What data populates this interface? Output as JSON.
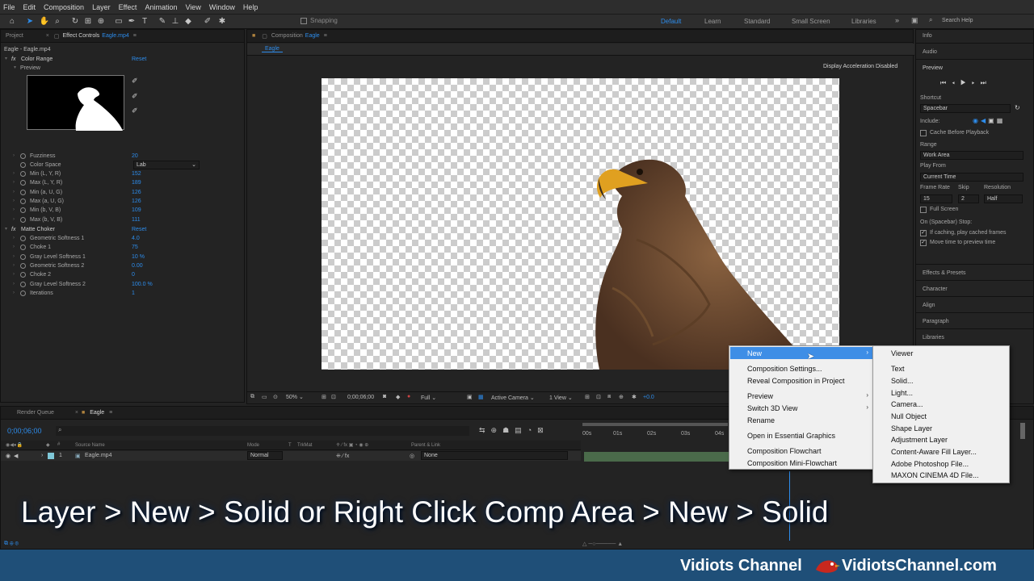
{
  "menu": [
    "File",
    "Edit",
    "Composition",
    "Layer",
    "Effect",
    "Animation",
    "View",
    "Window",
    "Help"
  ],
  "toolbar": {
    "snapping": "Snapping"
  },
  "workspaces": [
    "Default",
    "Learn",
    "Standard",
    "Small Screen",
    "Libraries"
  ],
  "search_placeholder": "Search Help",
  "left_panel": {
    "tab_project": "Project",
    "tab_effect_controls": "Effect Controls",
    "tab_file": "Eagle.mp4",
    "layer_path": "Eagle - Eagle.mp4",
    "color_range": {
      "name": "Color Range",
      "reset": "Reset",
      "preview_label": "Preview"
    },
    "properties": [
      {
        "label": "Fuzziness",
        "value": "20"
      },
      {
        "label": "Color Space",
        "value": "Lab"
      },
      {
        "label": "Min (L, Y, R)",
        "value": "152"
      },
      {
        "label": "Max (L, Y, R)",
        "value": "189"
      },
      {
        "label": "Min (a, U, G)",
        "value": "126"
      },
      {
        "label": "Max (a, U, G)",
        "value": "126"
      },
      {
        "label": "Min (b, V, B)",
        "value": "109"
      },
      {
        "label": "Max (b, V, B)",
        "value": "111"
      }
    ],
    "matte_choker": {
      "name": "Matte Choker",
      "reset": "Reset"
    },
    "matte_props": [
      {
        "label": "Geometric Softness 1",
        "value": "4.0"
      },
      {
        "label": "Choke 1",
        "value": "75"
      },
      {
        "label": "Gray Level Softness 1",
        "value": "10 %"
      },
      {
        "label": "Geometric Softness 2",
        "value": "0.00"
      },
      {
        "label": "Choke 2",
        "value": "0"
      },
      {
        "label": "Gray Level Softness 2",
        "value": "100.0 %"
      },
      {
        "label": "Iterations",
        "value": "1"
      }
    ]
  },
  "comp": {
    "tab_label": "Composition",
    "tab_name": "Eagle",
    "sub_tab": "Eagle",
    "accel_notice": "Display Acceleration Disabled",
    "zoom": "50%",
    "timecode": "0;00;06;00",
    "resolution": "Full",
    "camera": "Active Camera",
    "views": "1 View",
    "exposure": "+0.0"
  },
  "context_menu": {
    "items": [
      {
        "label": "New",
        "has_sub": true,
        "highlight": true
      },
      {
        "label": "Composition Settings...",
        "has_sub": false
      },
      {
        "label": "Reveal Composition in Project",
        "has_sub": false
      },
      {
        "label": "Preview",
        "has_sub": true
      },
      {
        "label": "Switch 3D View",
        "has_sub": true
      },
      {
        "label": "Rename",
        "has_sub": false
      },
      {
        "label": "Open in Essential Graphics",
        "has_sub": false
      },
      {
        "label": "Composition Flowchart",
        "has_sub": false
      },
      {
        "label": "Composition Mini-Flowchart",
        "has_sub": false
      }
    ]
  },
  "submenu": {
    "items": [
      "Viewer",
      "Text",
      "Solid...",
      "Light...",
      "Camera...",
      "Null Object",
      "Shape Layer",
      "Adjustment Layer",
      "Content-Aware Fill Layer...",
      "Adobe Photoshop File...",
      "MAXON CINEMA 4D File..."
    ]
  },
  "right_panel": {
    "info": "Info",
    "audio": "Audio",
    "preview": "Preview",
    "shortcut": "Shortcut",
    "shortcut_value": "Spacebar",
    "include": "Include:",
    "cache": "Cache Before Playback",
    "range": "Range",
    "range_value": "Work Area",
    "play_from": "Play From",
    "play_from_value": "Current Time",
    "frame_rate": "Frame Rate",
    "skip": "Skip",
    "resolution": "Resolution",
    "frame_rate_value": "15",
    "skip_value": "2",
    "resolution_value": "Half",
    "full_screen": "Full Screen",
    "on_stop": "On (Spacebar) Stop:",
    "if_caching": "If caching, play cached frames",
    "move_time": "Move time to preview time",
    "panels": [
      "Effects & Presets",
      "Character",
      "Align",
      "Paragraph",
      "Libraries"
    ]
  },
  "timeline": {
    "render_queue": "Render Queue",
    "comp_tab": "Eagle",
    "timecode": "0;00;06;00",
    "cols": {
      "source": "Source Name",
      "mode": "Mode",
      "t": "T",
      "trkmat": "TrkMat",
      "parent": "Parent & Link"
    },
    "layer": {
      "num": "1",
      "name": "Eagle.mp4",
      "mode": "Normal",
      "parent": "None"
    },
    "ruler": [
      "00s",
      "01s",
      "02s",
      "03s",
      "04s"
    ]
  },
  "caption": "Layer > New > Solid or Right Click Comp Area > New > Solid",
  "footer": {
    "left": "Vidiots Channel",
    "right": "VidiotsChannel.com"
  },
  "colors": {
    "accent": "#2d8ceb",
    "menu_highlight": "#3e8ee6",
    "footer": "#1f4f78"
  }
}
